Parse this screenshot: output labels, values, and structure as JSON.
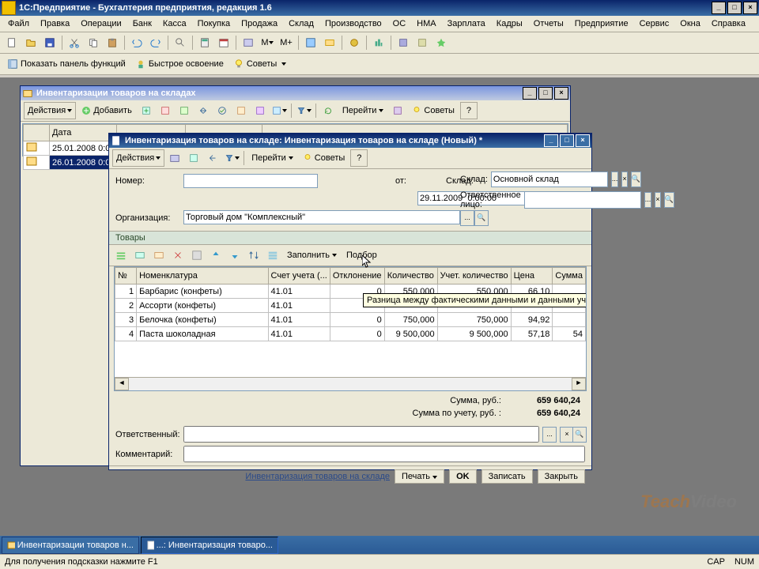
{
  "app": {
    "title": "1С:Предприятие - Бухгалтерия предприятия, редакция 1.6"
  },
  "menu": [
    "Файл",
    "Правка",
    "Операции",
    "Банк",
    "Касса",
    "Покупка",
    "Продажа",
    "Склад",
    "Производство",
    "ОС",
    "НМА",
    "Зарплата",
    "Кадры",
    "Отчеты",
    "Предприятие",
    "Сервис",
    "Окна",
    "Справка"
  ],
  "tb2": {
    "panel": "Показать панель функций",
    "fast": "Быстрое освоение",
    "tips": "Советы"
  },
  "backwin": {
    "title": "Инвентаризации товаров на складах",
    "actions": "Действия",
    "add": "Добавить",
    "go": "Перейти",
    "tips": "Советы",
    "col_date": "Дата",
    "dates": [
      "25.01.2008 0:0",
      "26.01.2008 0:0"
    ]
  },
  "frontwin": {
    "title": "Инвентаризация товаров на складе: Инвентаризация товаров на складе (Новый) *",
    "actions": "Действия",
    "go": "Перейти",
    "tips": "Советы",
    "lbl_num": "Номер:",
    "lbl_from": "от:",
    "val_from": "29.11.2009  0:00:00",
    "lbl_wh": "Склад:",
    "val_wh": "Основной склад",
    "lbl_org": "Организация:",
    "val_org": "Торговый дом \"Комплексный\"",
    "lbl_resp": "Ответственное лицо:",
    "tab": "Товары",
    "fill": "Заполнить",
    "pick": "Подбор",
    "cols": {
      "n": "№",
      "nom": "Номенклатура",
      "acct": "Счет учета (...",
      "dev": "Отклонение",
      "qty": "Количество",
      "aqty": "Учет. количество",
      "price": "Цена",
      "sum": "Сумма"
    },
    "rows": [
      {
        "n": "1",
        "nom": "Барбарис (конфеты)",
        "acct": "41.01",
        "dev": "0",
        "qty": "550,000",
        "aqty": "550,000",
        "price": "66,10",
        "sum": ""
      },
      {
        "n": "2",
        "nom": "Ассорти (конфеты)",
        "acct": "41.01",
        "dev": "",
        "qty": "",
        "aqty": "",
        "price": "",
        "sum": ""
      },
      {
        "n": "3",
        "nom": "Белочка (конфеты)",
        "acct": "41.01",
        "dev": "0",
        "qty": "750,000",
        "aqty": "750,000",
        "price": "94,92",
        "sum": ""
      },
      {
        "n": "4",
        "nom": "Паста шоколадная",
        "acct": "41.01",
        "dev": "0",
        "qty": "9 500,000",
        "aqty": "9 500,000",
        "price": "57,18",
        "sum": "54"
      }
    ],
    "tooltip": "Разница между фактическими данными и данными учета",
    "sum_lbl": "Сумма, руб.:",
    "sum_val": "659 640,24",
    "sum2_lbl": "Сумма по учету, руб. :",
    "sum2_val": "659 640,24",
    "lbl_r2": "Ответственный:",
    "lbl_comm": "Комментарий:",
    "link": "Инвентаризация товаров на складе",
    "print": "Печать",
    "ok": "OK",
    "save": "Записать",
    "close": "Закрыть"
  },
  "task": {
    "t1": "Инвентаризации товаров н...",
    "t2": "...: Инвентаризация товаро..."
  },
  "status": {
    "hint": "Для получения подсказки нажмите F1",
    "cap": "CAP",
    "num": "NUM"
  }
}
